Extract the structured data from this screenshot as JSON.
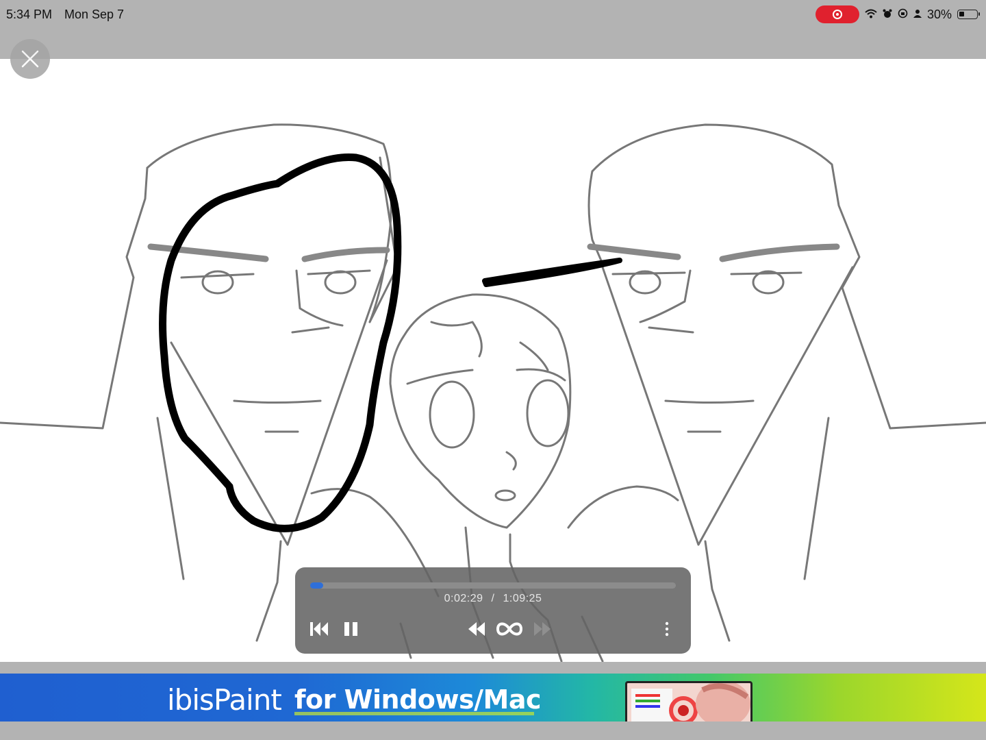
{
  "status_bar": {
    "time": "5:34 PM",
    "date": "Mon Sep 7",
    "battery": "30%",
    "battery_level": 0.3,
    "icons": [
      "screen-record-icon",
      "wifi-icon",
      "alarm-icon",
      "orientation-lock-icon",
      "person-icon",
      "battery-icon"
    ]
  },
  "viewer": {
    "close_icon": "close-icon"
  },
  "player": {
    "current_time": "0:02:29",
    "separator": "/",
    "total_time": "1:09:25",
    "progress": 0.036,
    "controls": [
      "skip-to-start-icon",
      "pause-icon",
      "rewind-icon",
      "loop-icon",
      "fast-forward-icon",
      "more-icon"
    ]
  },
  "ad": {
    "brand": "ibisPaint",
    "tagline": "for Windows/Mac"
  },
  "colors": {
    "record_red": "#e0212e",
    "progress_blue": "#2f6fd8",
    "chrome_gray": "#b3b3b3"
  }
}
